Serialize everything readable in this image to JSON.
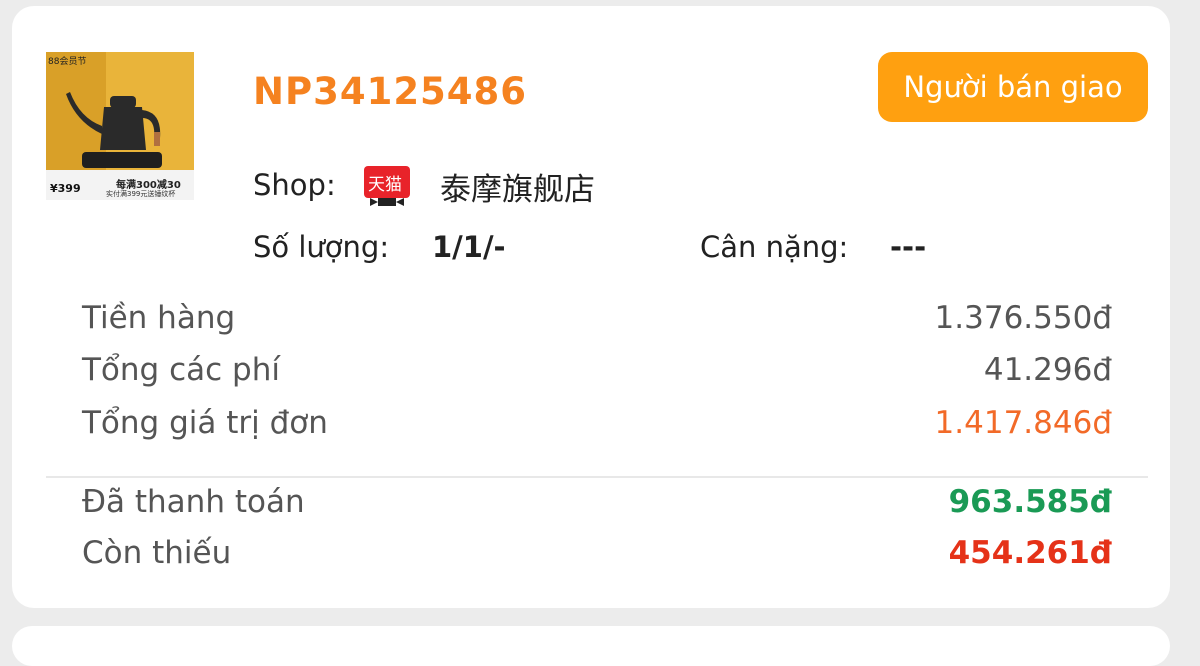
{
  "order": {
    "id": "NP34125486",
    "status_label": "Người bán giao",
    "product_image": {
      "alt": "electric kettle",
      "promo_badge": "88会员节",
      "price_tag": "¥399",
      "promo_line1": "每满300减30",
      "promo_line2": "实付满399元送锤纹杯"
    },
    "shop": {
      "label": "Shop:",
      "logo_text": "天猫",
      "name": "泰摩旗舰店"
    },
    "quantity": {
      "label": "Số lượng:",
      "value": "1/1/-"
    },
    "weight": {
      "label": "Cân nặng:",
      "value": "---"
    }
  },
  "summary": {
    "rows": [
      {
        "label": "Tiền hàng",
        "value": "1.376.550đ"
      },
      {
        "label": "Tổng các phí",
        "value": "41.296đ"
      },
      {
        "label": "Tổng giá trị đơn",
        "value": "1.417.846đ"
      }
    ],
    "paid": {
      "label": "Đã thanh toán",
      "value": "963.585đ"
    },
    "remaining": {
      "label": "Còn thiếu",
      "value": "454.261đ"
    }
  },
  "colors": {
    "accent_orange": "#f58220",
    "button_orange": "#ffa010",
    "total_orange": "#f26a28",
    "paid_green": "#1a9a55",
    "due_red": "#e53218",
    "tmall_red": "#e8232a"
  }
}
